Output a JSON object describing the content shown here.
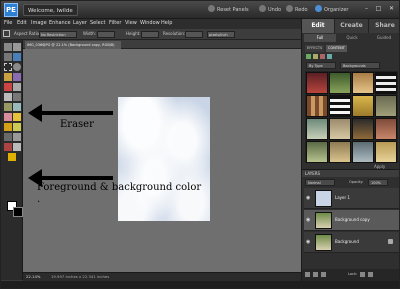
{
  "titlebar": {
    "logo": "PE",
    "welcome": "Welcome, Iwilde",
    "reset_panels": "Reset Panels",
    "undo": "Undo",
    "redo": "Redo",
    "organizer": "Organizer",
    "minimize": "–",
    "maximize": "□",
    "close": "✕"
  },
  "menu": [
    "File",
    "Edit",
    "Image",
    "Enhance",
    "Layer",
    "Select",
    "Filter",
    "View",
    "Window",
    "Help"
  ],
  "options_bar": {
    "aspect_ratio_label": "Aspect Ratio:",
    "aspect_ratio_value": "No Restriction",
    "width_label": "Width:",
    "height_label": "Height:",
    "resolution_label": "Resolution:",
    "resolution_unit": "pixels/inch"
  },
  "document_tab": "IMG_0366JPG @ 22.1% (Background copy, RGB/8)",
  "annotations": {
    "eraser": "Eraser",
    "fg_bg": "Foreground & background color",
    "dot": "."
  },
  "status": {
    "zoom": "22.14%",
    "doc_size": "19.997 inches x 22.341 inches"
  },
  "right_panel": {
    "mode_tabs": [
      "Edit",
      "Create",
      "Share"
    ],
    "sub_tabs": [
      "Full",
      "Quick",
      "Guided"
    ],
    "effects_tabs": [
      "EFFECTS",
      "CONTENT"
    ],
    "content_filter": "By Type",
    "content_category": "Backgrounds",
    "apply_label": "Apply",
    "layers_header": "LAYERS",
    "blend_mode": "Normal",
    "opacity_label": "Opacity:",
    "opacity_value": "100%",
    "lock_label": "Lock:",
    "layers": [
      {
        "name": "Layer 1",
        "selected": false
      },
      {
        "name": "Background copy",
        "selected": true
      },
      {
        "name": "Background",
        "selected": false
      }
    ]
  },
  "colors": {
    "foreground": "#ffffff",
    "background": "#000000",
    "accent": "#2f7fd0"
  }
}
